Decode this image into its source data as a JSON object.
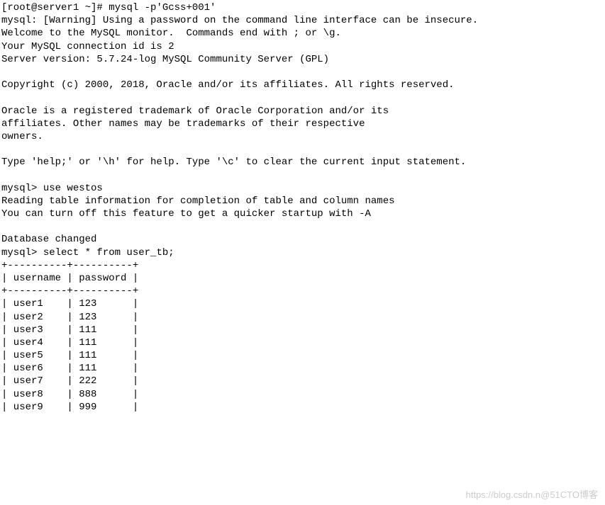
{
  "line1": {
    "prompt": "[root@server1 ~]# ",
    "command": "mysql -p'Gcss+001'"
  },
  "line2": "mysql: [Warning] Using a password on the command line interface can be insecure.",
  "line3": "Welcome to the MySQL monitor.  Commands end with ; or \\g.",
  "line4": "Your MySQL connection id is 2",
  "line5": "Server version: 5.7.24-log MySQL Community Server (GPL)",
  "line6": "Copyright (c) 2000, 2018, Oracle and/or its affiliates. All rights reserved.",
  "line7": "Oracle is a registered trademark of Oracle Corporation and/or its",
  "line8": "affiliates. Other names may be trademarks of their respective",
  "line9": "owners.",
  "line10": "Type 'help;' or '\\h' for help. Type '\\c' to clear the current input statement.",
  "line11": {
    "prompt": "mysql> ",
    "command": "use westos"
  },
  "line12": "Reading table information for completion of table and column names",
  "line13": "You can turn off this feature to get a quicker startup with -A",
  "line14": "Database changed",
  "line15": {
    "prompt": "mysql> ",
    "command": "select * from user_tb;"
  },
  "table": {
    "border": "+----------+----------+",
    "header": "| username | password |",
    "rows": [
      "| user1    | 123      |",
      "| user2    | 123      |",
      "| user3    | 111      |",
      "| user4    | 111      |",
      "| user5    | 111      |",
      "| user6    | 111      |",
      "| user7    | 222      |",
      "| user8    | 888      |",
      "| user9    | 999      |"
    ]
  },
  "watermark": {
    "part1": "https://blog.csdn.n",
    "part2": "@51CTO博客"
  }
}
